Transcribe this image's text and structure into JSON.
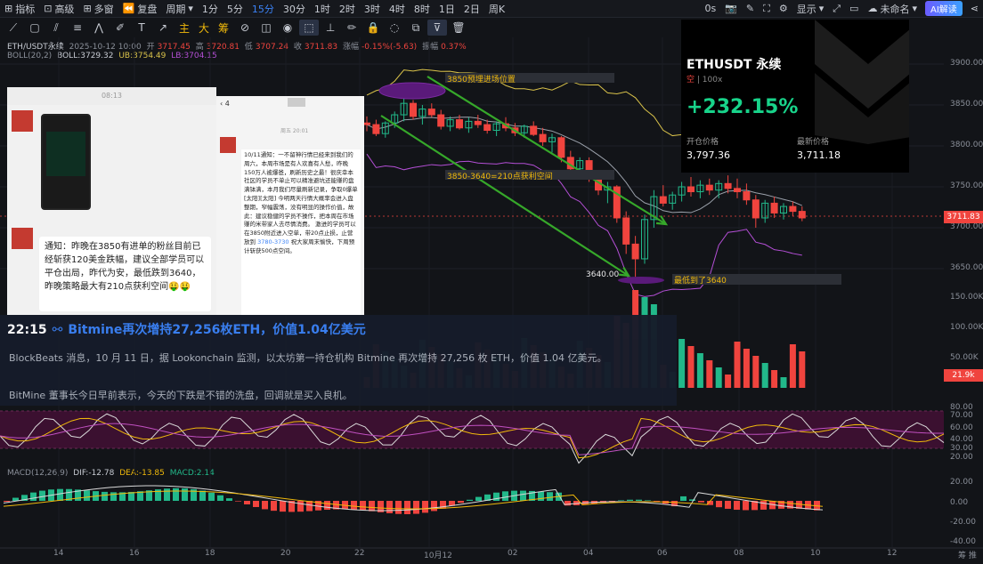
{
  "topbar": {
    "indicator_label": "指标",
    "advanced_label": "高级",
    "multi_window_label": "多窗",
    "replay_label": "复盘",
    "period_label": "周期",
    "periods": [
      "1分",
      "5分",
      "15分",
      "30分",
      "1时",
      "2时",
      "3时",
      "4时",
      "8时",
      "1日",
      "2日",
      "周K"
    ],
    "active_period": "15分",
    "zero_s": "0s",
    "display_label": "显示",
    "unnamed_label": "未命名",
    "ai_label": "AI解读"
  },
  "toolbar": {
    "text_tools": [
      "主",
      "大",
      "筹"
    ]
  },
  "legend": {
    "symbol": "ETH/USDT永续",
    "datetime": "2025-10-12 10:00",
    "open_label": "开",
    "open": "3717.45",
    "high_label": "高",
    "high": "3720.81",
    "low_label": "低",
    "low": "3707.24",
    "close_label": "收",
    "close": "3711.83",
    "change_label": "涨幅",
    "change": "-0.15%(-5.63)",
    "amp_label": "振幅",
    "amp": "0.37%",
    "boll_name": "BOLL(20,2)",
    "boll": "BOLL:3729.32",
    "ub": "UB:3754.49",
    "lb": "LB:3704.15",
    "macd_name": "MACD(12,26,9)",
    "dif": "DIF:-12.78",
    "dea": "DEA:-13.85",
    "macd": "MACD:2.14"
  },
  "price_axis": [
    "3900.00",
    "3850.00",
    "3800.00",
    "3750.00",
    "3700.00",
    "3650.00"
  ],
  "current_price": "3711.83",
  "volume_axis": [
    "150.00K",
    "100.00K",
    "50.00K"
  ],
  "volume_tag": "21.9k",
  "rsi_axis": [
    "80.00",
    "70.00",
    "60.00",
    "40.00",
    "30.00",
    "20.00"
  ],
  "macd_axis": [
    "20.00",
    "0.00",
    "-20.00",
    "-40.00"
  ],
  "date_axis": [
    "14",
    "16",
    "18",
    "20",
    "22",
    "10月12",
    "02",
    "04",
    "06",
    "08",
    "10",
    "12"
  ],
  "corner_label": "筹 推",
  "annotations": {
    "entry": "3850预埋进场位置",
    "profit": "3850-3640=210点获利空间",
    "low_mark": "3640.00",
    "lowest": "最低到了3640"
  },
  "card": {
    "symbol": "ETHUSDT 永续",
    "side": "空",
    "leverage": "100x",
    "pnl": "+232.15%",
    "open_label": "开仓价格",
    "open_price": "3,797.36",
    "last_label": "最新价格",
    "last_price": "3,711.18"
  },
  "screenshot_left": {
    "time": "08:13",
    "message": "通知：昨晚在3850有进单的粉丝目前已经斩获120美金跌幅，建议全部学员可以平仓出局，昨代为安，最低跌到3640，昨晚策略最大有210点获利空间",
    "emoji": "🤑🤑"
  },
  "screenshot_right": {
    "back": "4",
    "date": "周五 20:01",
    "message": "10/11通知：一不留神行情已经来到我们的周六，本周市场是有人欢喜有人愁，昨晚150万人被爆爸，刷新历史之最！很庆幸本社区的学员不单止可以精准避坑还能赚的盘满钵满，本月我们尽量刷新记录，争取0爆单[太阳][太阳] 今明两天行情大概率会进入盘整期，窄幅震荡，没有明显的操作价值，故此：建议稳健的学员不操作，把本周在市场赚的米带家人去尽情消费。 激进的学员可以在3850附近进入空单，带20点止损，止营放到",
    "target": "3780-3730",
    "tail": "祝大家周末愉快，下周预计斩获500点空间。"
  },
  "news": {
    "time": "22:15",
    "headline": "Bitmine再次增持27,256枚ETH，价值1.04亿美元",
    "line1": "BlockBeats 消息，10 月 11 日，据 Lookonchain 监测，以太坊第一持仓机构 Bitmine 再次增持 27,256 枚 ETH，价值 1.04 亿美元。",
    "line2": "BitMine 董事长今日早前表示，今天的下跌是不错的洗盘，回调就是买入良机。"
  },
  "colors": {
    "up": "#22b88a",
    "down": "#f0443e",
    "accent": "#3b82f6",
    "gold": "#f0b90b",
    "boll_ub": "#d9c24a",
    "boll_lb": "#b44fd6",
    "boll_mid": "#9aa0aa"
  },
  "chart_data": {
    "type": "candlestick",
    "y_range": [
      3620,
      3920
    ],
    "candles": [
      [
        3828,
        3836,
        3818,
        3826
      ],
      [
        3826,
        3832,
        3812,
        3815
      ],
      [
        3815,
        3830,
        3810,
        3828
      ],
      [
        3828,
        3842,
        3822,
        3838
      ],
      [
        3838,
        3860,
        3830,
        3852
      ],
      [
        3852,
        3856,
        3832,
        3836
      ],
      [
        3836,
        3850,
        3826,
        3845
      ],
      [
        3845,
        3852,
        3835,
        3838
      ],
      [
        3838,
        3844,
        3820,
        3824
      ],
      [
        3824,
        3836,
        3818,
        3832
      ],
      [
        3832,
        3838,
        3820,
        3822
      ],
      [
        3822,
        3835,
        3816,
        3830
      ],
      [
        3830,
        3838,
        3822,
        3826
      ],
      [
        3826,
        3832,
        3815,
        3819
      ],
      [
        3819,
        3830,
        3812,
        3827
      ],
      [
        3827,
        3835,
        3818,
        3822
      ],
      [
        3822,
        3828,
        3812,
        3816
      ],
      [
        3816,
        3826,
        3810,
        3824
      ],
      [
        3824,
        3830,
        3812,
        3814
      ],
      [
        3814,
        3822,
        3800,
        3805
      ],
      [
        3805,
        3815,
        3792,
        3810
      ],
      [
        3810,
        3812,
        3780,
        3786
      ],
      [
        3786,
        3794,
        3768,
        3772
      ],
      [
        3772,
        3786,
        3764,
        3782
      ],
      [
        3782,
        3786,
        3756,
        3760
      ],
      [
        3760,
        3768,
        3740,
        3746
      ],
      [
        3746,
        3756,
        3730,
        3750
      ],
      [
        3750,
        3752,
        3706,
        3712
      ],
      [
        3712,
        3720,
        3668,
        3680
      ],
      [
        3680,
        3690,
        3640,
        3662
      ],
      [
        3662,
        3716,
        3656,
        3710
      ],
      [
        3710,
        3746,
        3700,
        3738
      ],
      [
        3738,
        3752,
        3726,
        3730
      ],
      [
        3730,
        3744,
        3722,
        3740
      ],
      [
        3740,
        3756,
        3732,
        3750
      ],
      [
        3750,
        3762,
        3738,
        3744
      ],
      [
        3744,
        3758,
        3736,
        3752
      ],
      [
        3752,
        3760,
        3740,
        3746
      ],
      [
        3746,
        3758,
        3736,
        3754
      ],
      [
        3754,
        3764,
        3742,
        3748
      ],
      [
        3748,
        3760,
        3736,
        3744
      ],
      [
        3744,
        3754,
        3728,
        3734
      ],
      [
        3734,
        3740,
        3700,
        3712
      ],
      [
        3712,
        3734,
        3706,
        3730
      ],
      [
        3730,
        3738,
        3712,
        3718
      ],
      [
        3718,
        3730,
        3710,
        3726
      ],
      [
        3726,
        3732,
        3714,
        3720
      ],
      [
        3720,
        3726,
        3708,
        3712
      ]
    ]
  }
}
